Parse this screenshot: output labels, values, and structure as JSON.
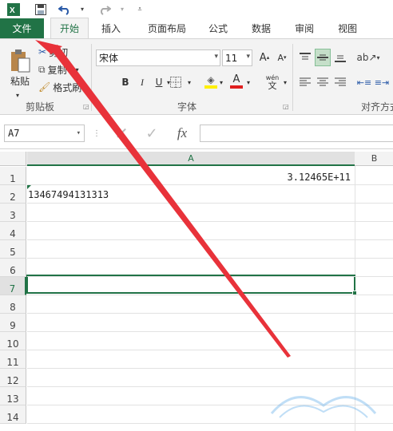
{
  "qat": {
    "icons": [
      "excel-icon",
      "save-icon",
      "undo-icon",
      "redo-icon",
      "customize-icon"
    ]
  },
  "tabs": [
    {
      "label": "文件"
    },
    {
      "label": "开始"
    },
    {
      "label": "插入"
    },
    {
      "label": "页面布局"
    },
    {
      "label": "公式"
    },
    {
      "label": "数据"
    },
    {
      "label": "审阅"
    },
    {
      "label": "视图"
    }
  ],
  "ribbon": {
    "clipboard": {
      "paste": "粘贴",
      "cut": "剪切",
      "copy": "复制",
      "format_painter": "格式刷",
      "group_label": "剪贴板"
    },
    "font": {
      "name": "宋体",
      "size": "11",
      "bold": "B",
      "italic": "I",
      "underline": "U",
      "phonetic": "wén",
      "group_label": "字体"
    },
    "alignment": {
      "group_label": "对齐方式"
    }
  },
  "formula_bar": {
    "name_box": "A7",
    "fx": "fx",
    "value": ""
  },
  "sheet": {
    "columns": [
      "A",
      "B"
    ],
    "rows": [
      "1",
      "2",
      "3",
      "4",
      "5",
      "6",
      "7",
      "8",
      "9",
      "10",
      "11",
      "12",
      "13",
      "14"
    ],
    "cells": {
      "A1": "3.12465E+11",
      "A2": "13467494131313"
    },
    "selected": "A7"
  },
  "colors": {
    "accent": "#217346",
    "arrow": "#e8323a"
  }
}
